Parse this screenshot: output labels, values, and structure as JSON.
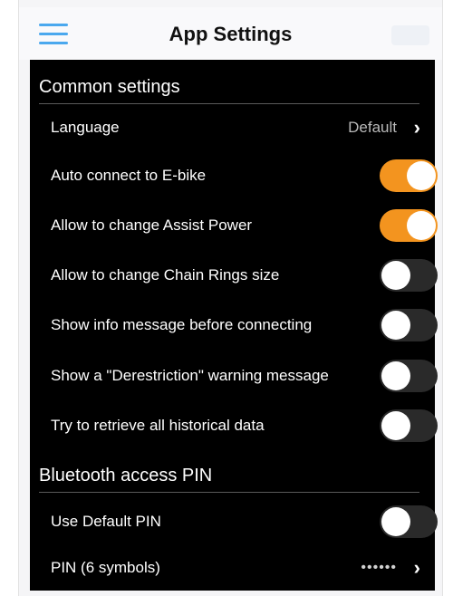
{
  "header": {
    "title": "App Settings",
    "menu_icon": "hamburger-menu-icon"
  },
  "sections": {
    "common": {
      "title": "Common settings",
      "language": {
        "label": "Language",
        "value": "Default"
      },
      "auto_connect": {
        "label": "Auto connect to E-bike",
        "on": true
      },
      "assist_power": {
        "label": "Allow to change Assist Power",
        "on": true
      },
      "chain_rings": {
        "label": "Allow to change Chain Rings size",
        "on": false
      },
      "info_message": {
        "label": "Show info message before connecting",
        "on": false
      },
      "derestriction": {
        "label": "Show a \"Derestriction\" warning message",
        "on": false
      },
      "historical": {
        "label": "Try to retrieve all historical data",
        "on": false
      }
    },
    "bluetooth": {
      "title": "Bluetooth access PIN",
      "default_pin": {
        "label": "Use Default PIN",
        "on": false
      },
      "pin": {
        "label": "PIN (6 symbols)",
        "value": "••••••"
      }
    }
  },
  "chevron": "›",
  "colors": {
    "toggle_on": "#f3941f",
    "accent_blue": "#4aa8ee",
    "panel_bg": "#000000"
  }
}
